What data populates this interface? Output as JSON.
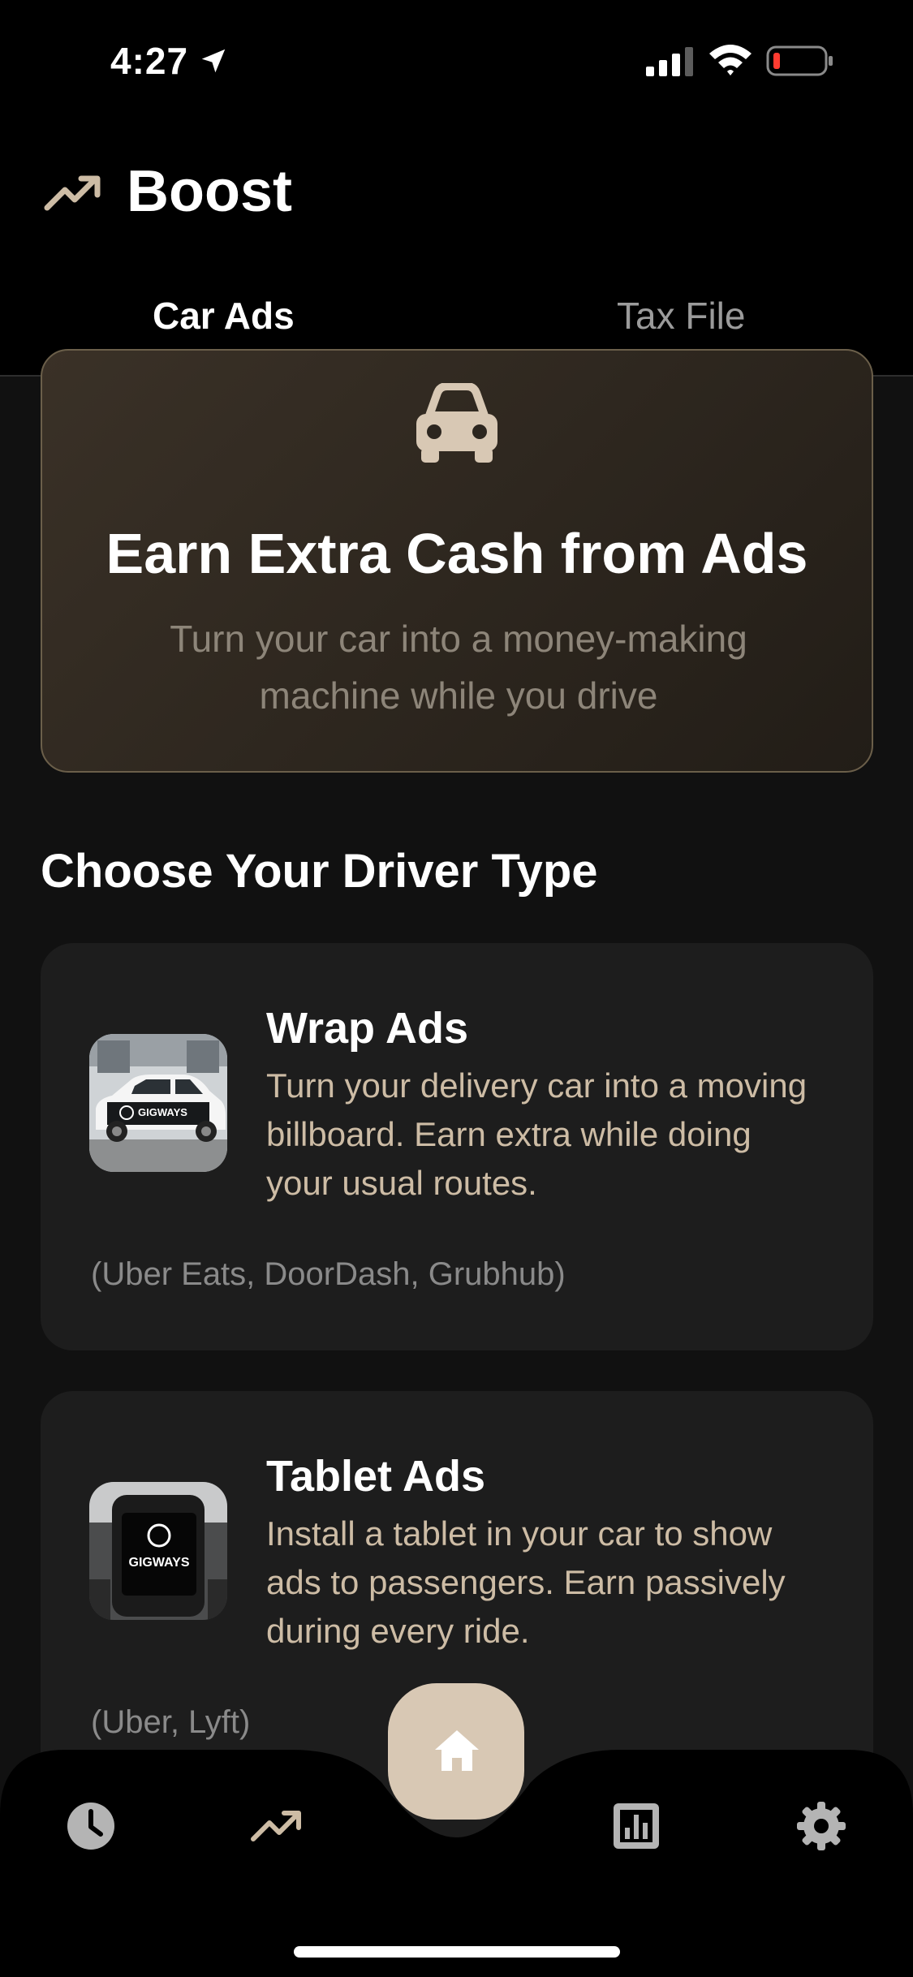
{
  "status_bar": {
    "time": "4:27",
    "icons": [
      "location-arrow-icon",
      "signal-icon",
      "wifi-icon",
      "battery-low-icon"
    ]
  },
  "header": {
    "icon": "trending-up-icon",
    "title": "Boost",
    "tabs": [
      {
        "label": "Car Ads",
        "active": true
      },
      {
        "label": "Tax File",
        "active": false
      }
    ]
  },
  "hero": {
    "icon": "car-icon",
    "title": "Earn Extra Cash from Ads",
    "subtitle": "Turn your car into a money-making machine while you drive"
  },
  "section_title": "Choose Your Driver Type",
  "driver_types": [
    {
      "title": "Wrap Ads",
      "description": "Turn your delivery car into a moving billboard. Earn extra while doing your usual routes.",
      "platforms": "(Uber Eats, DoorDash, Grubhub)",
      "thumb_brand": "GIGWAYS"
    },
    {
      "title": "Tablet Ads",
      "description": "Install a tablet in your car to show ads to passengers. Earn passively during every ride.",
      "platforms": "(Uber, Lyft)",
      "thumb_brand": "GIGWAYS"
    }
  ],
  "bottom_nav": {
    "items": [
      "clock-icon",
      "trending-up-icon",
      "home-icon",
      "analytics-icon",
      "settings-icon"
    ],
    "active": "home-icon"
  },
  "colors": {
    "background": "#111111",
    "accent": "#d8c8b4",
    "card": "#1d1d1d",
    "desc_text": "#cdbca5"
  }
}
